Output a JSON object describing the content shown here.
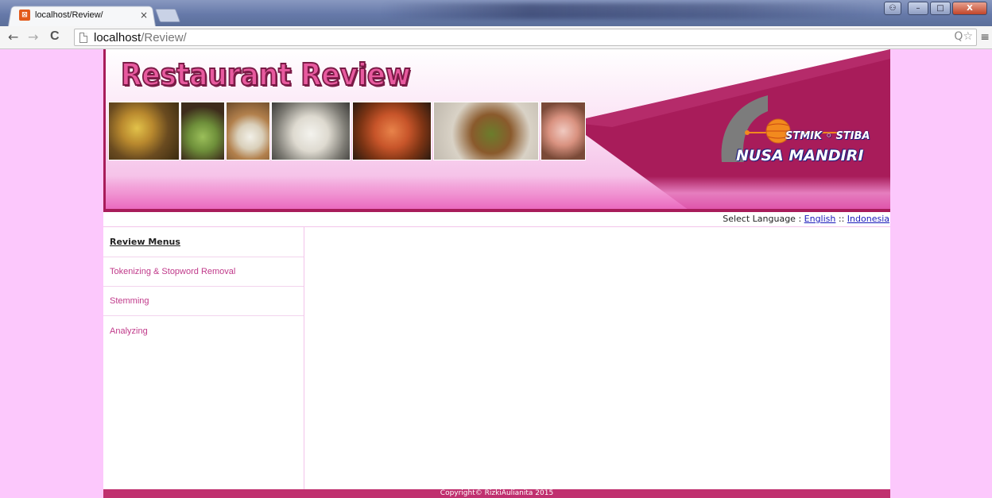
{
  "browser": {
    "tab_title": "localhost/Review/",
    "tab_close": "×",
    "url_host": "localhost",
    "url_path": "/Review/",
    "nav": {
      "back": "←",
      "forward": "→",
      "reload": "C"
    },
    "omnibox_icons": "Q☆",
    "menu_icon": "≡",
    "window_buttons": {
      "minimize": "–",
      "maximize": "□",
      "close": "X"
    }
  },
  "header": {
    "title": "Restaurant Review",
    "logo_line1": "STMIK ◦ STIBA",
    "logo_line2": "NUSA MANDIRI"
  },
  "language": {
    "label": "Select Language : ",
    "option_english": "English",
    "separator": " :: ",
    "option_indonesia": "Indonesia"
  },
  "sidebar": {
    "heading": "Review Menus",
    "items": [
      {
        "label": "Tokenizing & Stopword Removal"
      },
      {
        "label": "Stemming"
      },
      {
        "label": "Analyzing"
      }
    ]
  },
  "footer": {
    "copyright": "Copyright© RizkiAulianita 2015"
  },
  "colors": {
    "page_bg": "#fcc8fc",
    "brand_magenta": "#a81c5a",
    "footer": "#c0306f",
    "menu_text": "#c03a8a",
    "link": "#1a1aba"
  }
}
